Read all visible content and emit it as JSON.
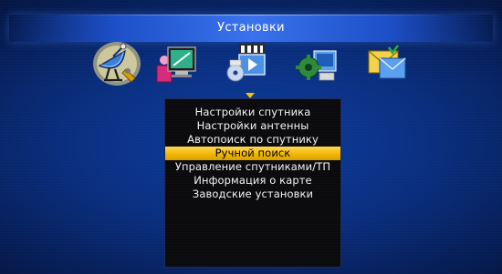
{
  "header": {
    "title": "Установки"
  },
  "categories": [
    {
      "icon": "satellite-dish-icon",
      "selected": true
    },
    {
      "icon": "display-settings-icon",
      "selected": false
    },
    {
      "icon": "media-icon",
      "selected": false
    },
    {
      "icon": "system-tools-icon",
      "selected": false
    },
    {
      "icon": "mail-icon",
      "selected": false
    }
  ],
  "menu": {
    "selected_index": 3,
    "items": [
      {
        "label": "Настройки спутника"
      },
      {
        "label": "Настройки антенны"
      },
      {
        "label": "Автопоиск по спутнику"
      },
      {
        "label": "Ручной поиск"
      },
      {
        "label": "Управление спутниками/ТП"
      },
      {
        "label": "Информация о карте"
      },
      {
        "label": "Заводские установки"
      }
    ]
  },
  "colors": {
    "background": "#0a2f80",
    "title_bar": "#2a5fe0",
    "menu_panel": "#0b0b0e",
    "highlight": "#f0b800",
    "text": "#f4f4f4"
  }
}
